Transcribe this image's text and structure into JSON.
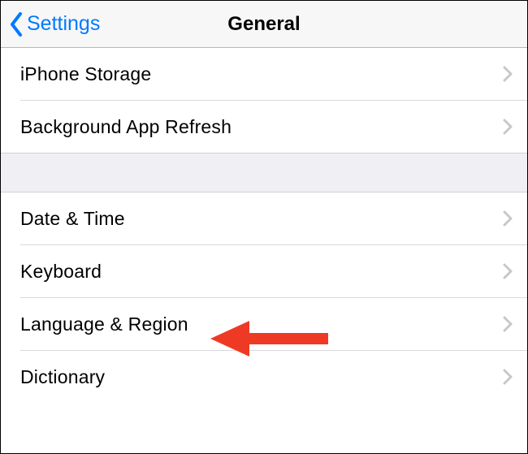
{
  "nav": {
    "back_label": "Settings",
    "title": "General"
  },
  "sections": [
    {
      "rows": [
        {
          "label": "iPhone Storage"
        },
        {
          "label": "Background App Refresh"
        }
      ]
    },
    {
      "rows": [
        {
          "label": "Date & Time"
        },
        {
          "label": "Keyboard"
        },
        {
          "label": "Language & Region"
        },
        {
          "label": "Dictionary"
        }
      ]
    }
  ],
  "annotation": {
    "arrow_color": "#ee3a24"
  }
}
